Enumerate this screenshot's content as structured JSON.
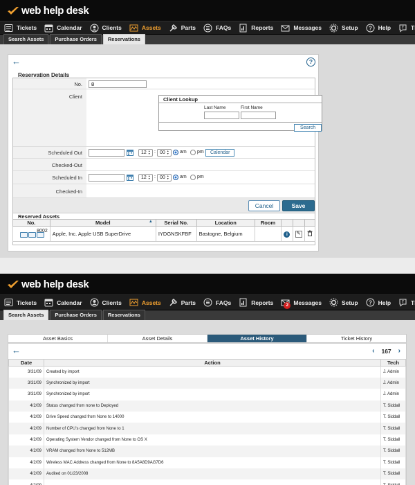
{
  "app": {
    "logo_text": "web help desk",
    "accent": "#f0a030",
    "link_color": "#1f5f8b"
  },
  "nav": {
    "items": [
      {
        "label": "Tickets",
        "icon": "tickets-icon"
      },
      {
        "label": "Calendar",
        "icon": "calendar-icon"
      },
      {
        "label": "Clients",
        "icon": "clients-icon"
      },
      {
        "label": "Assets",
        "icon": "assets-icon",
        "active": true
      },
      {
        "label": "Parts",
        "icon": "parts-icon"
      },
      {
        "label": "FAQs",
        "icon": "faqs-icon"
      },
      {
        "label": "Reports",
        "icon": "reports-icon"
      },
      {
        "label": "Messages",
        "icon": "messages-icon"
      },
      {
        "label": "Setup",
        "icon": "setup-icon"
      },
      {
        "label": "Help",
        "icon": "help-icon"
      },
      {
        "label": "Thwack",
        "icon": "thwack-icon"
      }
    ],
    "messages_badge": "2"
  },
  "subtabs": [
    "Search Assets",
    "Purchase Orders",
    "Reservations"
  ],
  "reservation": {
    "section_title": "Reservation Details",
    "labels": {
      "no": "No.",
      "client": "Client",
      "scheduled_out": "Scheduled Out",
      "checked_out": "Checked-Out",
      "scheduled_in": "Scheduled In",
      "checked_in": "Checked-In"
    },
    "no_value": "8",
    "lookup": {
      "title": "Client Lookup",
      "first_name": "First Name",
      "last_name": "Last Name",
      "search": "Search"
    },
    "time": {
      "hour": "12",
      "minute": "00",
      "sep": ":",
      "am": "am",
      "pm": "pm"
    },
    "calendar_btn": "Calendar",
    "cancel": "Cancel",
    "save": "Save",
    "reserved_title": "Reserved Assets",
    "reserved_columns": [
      "No.",
      "Model",
      "Serial No.",
      "Location",
      "Room"
    ],
    "reserved_rows": [
      {
        "no": "8002",
        "model": "Apple, Inc. Apple USB SuperDrive",
        "serial": "IYDGNSKFBF",
        "location": "Bastogne, Belgium",
        "room": ""
      }
    ]
  },
  "history": {
    "tabs": [
      "Asset Basics",
      "Asset Details",
      "Asset History",
      "Ticket History"
    ],
    "active_tab": 2,
    "page_number": "167",
    "columns": [
      "Date",
      "Action",
      "Tech"
    ],
    "rows": [
      {
        "date": "3/31/09",
        "action": "Created by import",
        "tech": "J. Admin"
      },
      {
        "date": "3/31/09",
        "action": "Synchronized by import",
        "tech": "J. Admin"
      },
      {
        "date": "3/31/09",
        "action": "Synchronized by import",
        "tech": "J. Admin"
      },
      {
        "date": "4/2/09",
        "action": "Status changed from none to Deployed",
        "tech": "T. Siddall"
      },
      {
        "date": "4/2/09",
        "action": "Drive Speed changed from None to 14000",
        "tech": "T. Siddall"
      },
      {
        "date": "4/2/09",
        "action": "Number of CPU's changed from None to 1",
        "tech": "T. Siddall"
      },
      {
        "date": "4/2/09",
        "action": "Operating System Vendor changed from None to OS X",
        "tech": "T. Siddall"
      },
      {
        "date": "4/2/09",
        "action": "VRAM changed from None to 512MB",
        "tech": "T. Siddall"
      },
      {
        "date": "4/2/09",
        "action": "Wireless MAC Address changed from None to 8A5A8D9AG7D6",
        "tech": "T. Siddall"
      },
      {
        "date": "4/2/09",
        "action": "Audited on 01/23/2008",
        "tech": "T. Siddall"
      },
      {
        "date": "4/2/09",
        "action": "",
        "tech": "T. Siddall"
      }
    ]
  }
}
